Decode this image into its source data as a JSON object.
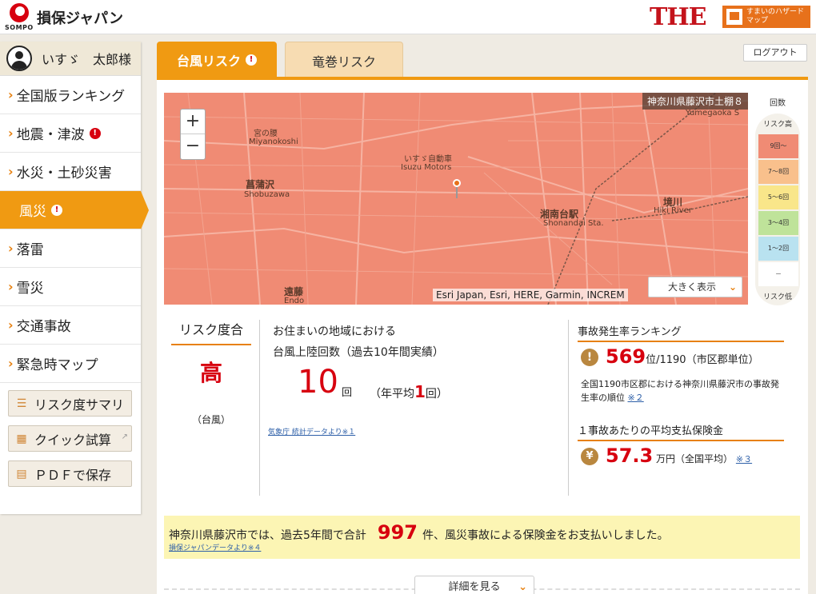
{
  "header": {
    "sompo_logo_text": "SOMPO",
    "brand_name": "損保ジャパン",
    "the_logo": "THE",
    "hazard_map_label": "すまいのハザードマップ"
  },
  "sidebar": {
    "user_name": "いすゞ　太郎様",
    "items": [
      {
        "label": "全国版ランキング"
      },
      {
        "label": "地震・津波",
        "warn": "!"
      },
      {
        "label": "水災・土砂災害"
      },
      {
        "label": "風災",
        "warn": "!"
      },
      {
        "label": "落雷"
      },
      {
        "label": "雪災"
      },
      {
        "label": "交通事故"
      },
      {
        "label": "緊急時マップ"
      }
    ],
    "tools": [
      {
        "label": "リスク度サマリ",
        "icon": "list-icon"
      },
      {
        "label": "クイック試算",
        "icon": "calculator-icon"
      },
      {
        "label": "ＰＤＦで保存",
        "icon": "pdf-icon"
      }
    ]
  },
  "tabs": {
    "active": {
      "label": "台風リスク",
      "warn": "!"
    },
    "inactive": {
      "label": "竜巻リスク"
    }
  },
  "logout_label": "ログアウト",
  "map": {
    "location": "神奈川県藤沢市土棚８",
    "attribution": "Esri Japan, Esri, HERE, Garmin, INCREM",
    "expand_label": "大きく表示",
    "labels": {
      "miyanokoshi": "宮の腰",
      "miyanokoshi_en": "Miyanokoshi",
      "shobuzawa": "菖蒲沢",
      "shobuzawa_en": "Shobuzawa",
      "isuzu": "いすゞ自動車",
      "isuzu_en": "Isuzu Motors",
      "shonandai": "湘南台駅",
      "shonandai_en": "Shonandai Sta.",
      "sakai": "境川",
      "sakai_en": "Hiki River",
      "endo": "遠藤",
      "endo_en": "Endo",
      "yumegaoka": "Yumegaoka S"
    }
  },
  "legend": {
    "title": "回数",
    "top_label": "リスク高",
    "bottom_label": "リスク低",
    "steps": [
      {
        "label": "9回～",
        "color": "#f08b74"
      },
      {
        "label": "7～8回",
        "color": "#f9c08c"
      },
      {
        "label": "5～6回",
        "color": "#f9e68a"
      },
      {
        "label": "3～4回",
        "color": "#bfe39a"
      },
      {
        "label": "1～2回",
        "color": "#b9e2f0"
      },
      {
        "label": "－",
        "color": "#ffffff"
      }
    ]
  },
  "risk": {
    "heading": "リスク度合",
    "value": "高",
    "type": "（台風）"
  },
  "landfall": {
    "line1": "お住まいの地域における",
    "line2": "台風上陸回数（過去10年間実績）",
    "count": "10",
    "count_unit": "回",
    "avg_prefix": "（年平均",
    "avg_value": "1",
    "avg_suffix": "回）",
    "source": "気象庁 統計データより※１"
  },
  "ranking": {
    "heading": "事故発生率ランキング",
    "rank": "569",
    "rank_suffix": "位/1190（市区郡単位）",
    "description": "全国1190市区郡における神奈川県藤沢市の事故発生率の順位",
    "note": "※２"
  },
  "payout": {
    "heading": "１事故あたりの平均支払保険金",
    "value": "57.3",
    "unit": "万円（全国平均）",
    "note": "※３"
  },
  "banner": {
    "prefix": "神奈川県藤沢市では、過去5年間で合計",
    "count": "997",
    "suffix": "件、風災事故による保険金をお支払いしました。",
    "source": "損保ジャパンデータより※４"
  },
  "detail_button": "詳細を見る"
}
